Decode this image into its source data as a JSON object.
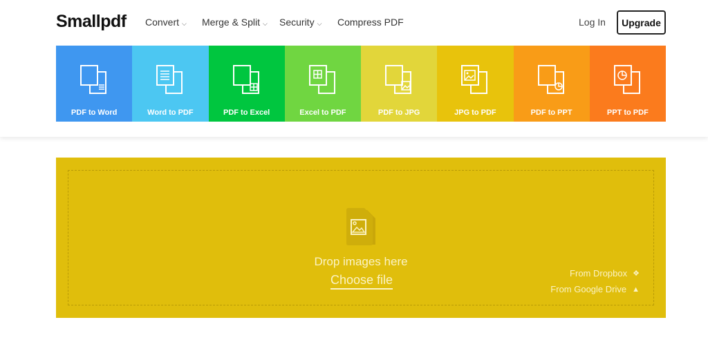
{
  "header": {
    "logo": "Smallpdf",
    "nav": [
      {
        "label": "Convert"
      },
      {
        "label": "Merge & Split"
      },
      {
        "label": "Security"
      },
      {
        "label": "Compress PDF"
      }
    ],
    "login": "Log In",
    "upgrade": "Upgrade"
  },
  "tools": [
    {
      "label": "PDF to Word",
      "color": "#3f97f0",
      "icon": "pdf-to-word-icon"
    },
    {
      "label": "Word to PDF",
      "color": "#4cc7f2",
      "icon": "word-to-pdf-icon"
    },
    {
      "label": "PDF to Excel",
      "color": "#00c63f",
      "icon": "pdf-to-excel-icon"
    },
    {
      "label": "Excel to PDF",
      "color": "#70d641",
      "icon": "excel-to-pdf-icon"
    },
    {
      "label": "PDF to JPG",
      "color": "#e2d63a",
      "icon": "pdf-to-jpg-icon"
    },
    {
      "label": "JPG to PDF",
      "color": "#e8c30c",
      "icon": "jpg-to-pdf-icon"
    },
    {
      "label": "PDF to PPT",
      "color": "#f99c17",
      "icon": "pdf-to-ppt-icon"
    },
    {
      "label": "PPT to PDF",
      "color": "#fb7b1d",
      "icon": "ppt-to-pdf-icon"
    }
  ],
  "dropzone": {
    "text": "Drop images here",
    "choose": "Choose file",
    "dropbox": "From Dropbox",
    "gdrive": "From Google Drive",
    "color": "#e0be0c"
  }
}
